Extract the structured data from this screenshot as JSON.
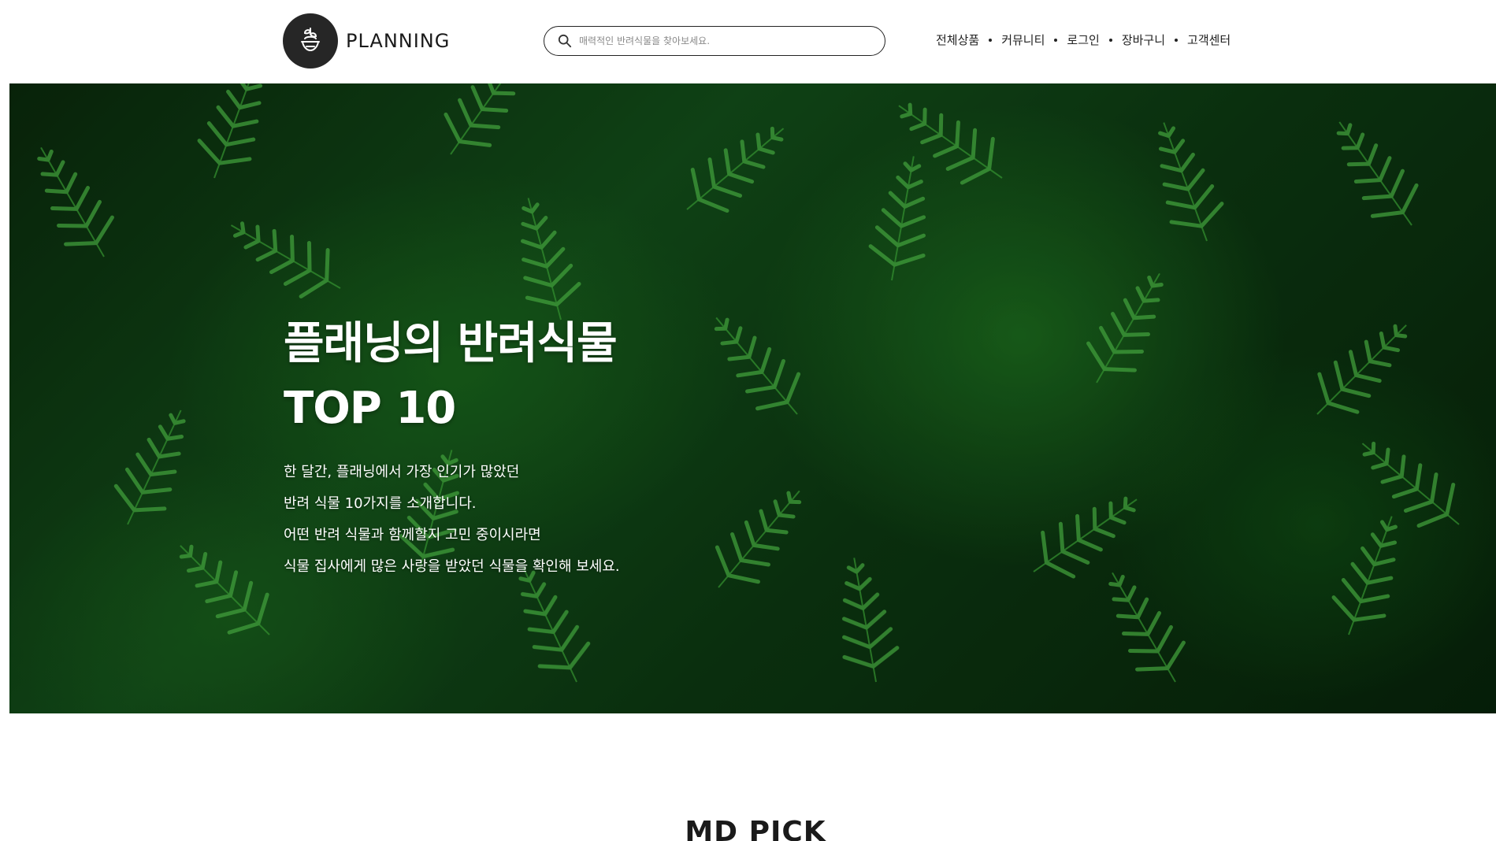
{
  "header": {
    "logo_text": "PLANNING",
    "logo_icon": "plant-bowl-icon",
    "search": {
      "placeholder": "매력적인 반려식물을 찾아보세요.",
      "value": ""
    },
    "nav": [
      "전체상품",
      "커뮤니티",
      "로그인",
      "장바구니",
      "고객센터"
    ]
  },
  "hero": {
    "title_line1": "플래닝의 반려식물",
    "title_line2": "TOP 10",
    "desc": [
      "한 달간, 플래닝에서 가장 인기가 많았던",
      "반려 식물 10가지를 소개합니다.",
      "어떤 반려 식물과 함께할지 고민 중이시라면",
      "식물 집사에게 많은 사랑을 받았던 식물을 확인해 보세요."
    ]
  },
  "section": {
    "title": "MD PICK"
  },
  "colors": {
    "header_bg": "#ffffff",
    "text": "#222222",
    "hero_green": "#13501a"
  }
}
